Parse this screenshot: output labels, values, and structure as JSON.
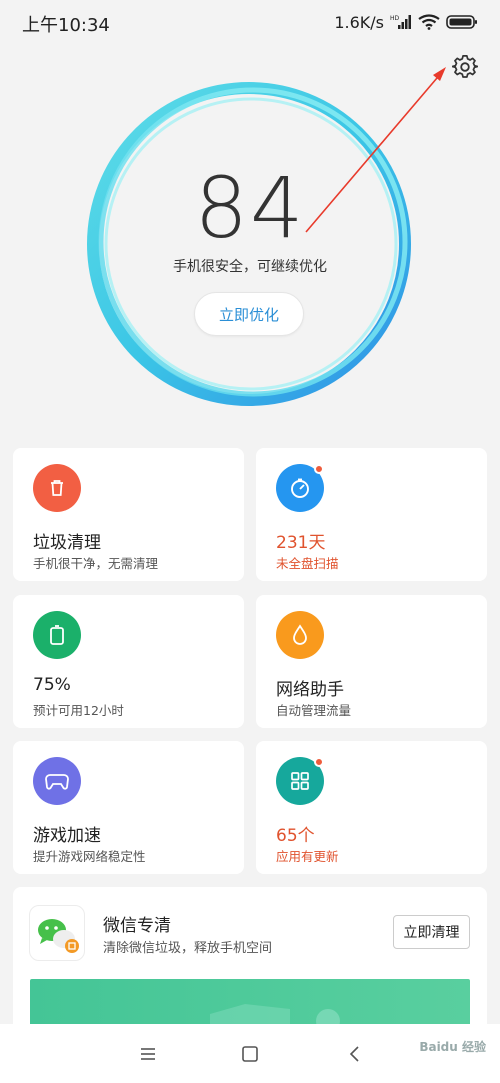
{
  "status_bar": {
    "time": "上午10:34",
    "net_speed": "1.6K/s"
  },
  "header": {
    "settings_icon": "gear-icon"
  },
  "score": {
    "value": "84",
    "subtitle": "手机很安全，可继续优化",
    "action_label": "立即优化"
  },
  "cards": [
    {
      "title": "垃圾清理",
      "subtitle": "手机很干净，无需清理",
      "icon": "trash-icon",
      "color": "#f25f43",
      "badge": false,
      "alert": false
    },
    {
      "title": "231天",
      "subtitle": "未全盘扫描",
      "icon": "scan-icon",
      "color": "#2596f0",
      "badge": true,
      "alert": true
    },
    {
      "title": "75%",
      "subtitle": "预计可用12小时",
      "icon": "battery-icon",
      "color": "#1bb06a",
      "badge": false,
      "alert": false
    },
    {
      "title": "网络助手",
      "subtitle": "自动管理流量",
      "icon": "drop-icon",
      "color": "#f99a1d",
      "badge": false,
      "alert": false
    },
    {
      "title": "游戏加速",
      "subtitle": "提升游戏网络稳定性",
      "icon": "gamepad-icon",
      "color": "#6f71e6",
      "badge": false,
      "alert": false
    },
    {
      "title": "65个",
      "subtitle": "应用有更新",
      "icon": "apps-icon",
      "color": "#16a89c",
      "badge": true,
      "alert": true
    }
  ],
  "wechat": {
    "title": "微信专清",
    "subtitle": "清除微信垃圾，释放手机空间",
    "action_label": "立即清理"
  },
  "watermark": "Baidu 经验"
}
